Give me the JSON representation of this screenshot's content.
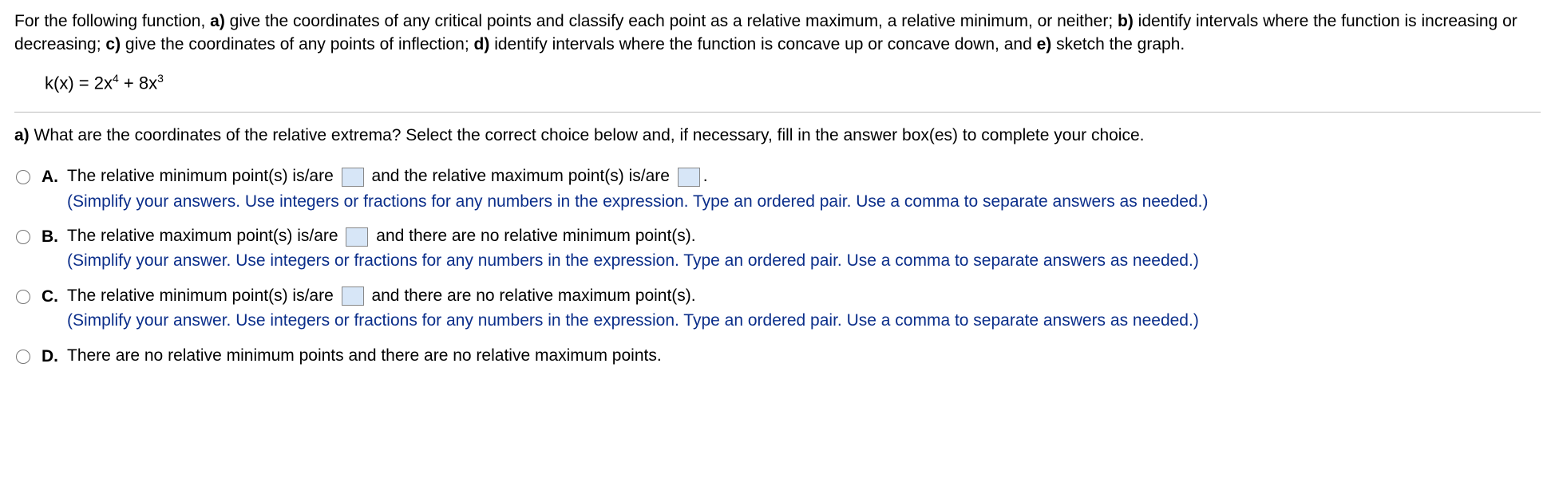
{
  "intro": {
    "seg1": "For the following function, ",
    "label_a": "a)",
    "seg2": " give the coordinates of any critical points and classify each point as a relative maximum, a relative minimum, or neither; ",
    "label_b": "b)",
    "seg3": " identify intervals where the function is increasing or decreasing; ",
    "label_c": "c)",
    "seg4": " give the coordinates of any points of inflection; ",
    "label_d": "d)",
    "seg5": " identify intervals where the function is concave up or concave down, and ",
    "label_e": "e)",
    "seg6": " sketch the graph."
  },
  "equation": {
    "lhs": "k(x) = 2x",
    "exp1": "4",
    "plus": " + 8x",
    "exp2": "3"
  },
  "part_a": {
    "label": "a)",
    "text": " What are the coordinates of the relative extrema? Select the correct choice below and, if necessary, fill in the answer box(es) to complete your choice."
  },
  "choices": {
    "A": {
      "letter": "A.",
      "line1_seg1": "The relative minimum point(s) is/are ",
      "line1_seg2": " and the relative maximum point(s) is/are ",
      "line1_seg3": ".",
      "hint": "(Simplify your answers. Use integers or fractions for any numbers in the expression. Type an ordered pair. Use a comma to separate answers as needed.)"
    },
    "B": {
      "letter": "B.",
      "line1_seg1": "The relative maximum point(s) is/are ",
      "line1_seg2": " and there are no relative minimum point(s).",
      "hint": "(Simplify your answer. Use integers or fractions for any numbers in the expression. Type an ordered pair. Use a comma to separate answers as needed.)"
    },
    "C": {
      "letter": "C.",
      "line1_seg1": "The relative minimum point(s) is/are ",
      "line1_seg2": " and there are no relative maximum point(s).",
      "hint": "(Simplify your answer. Use integers or fractions for any numbers in the expression. Type an ordered pair. Use a comma to separate answers as needed.)"
    },
    "D": {
      "letter": "D.",
      "line1": "There are no relative minimum points and there are no relative maximum points."
    }
  }
}
